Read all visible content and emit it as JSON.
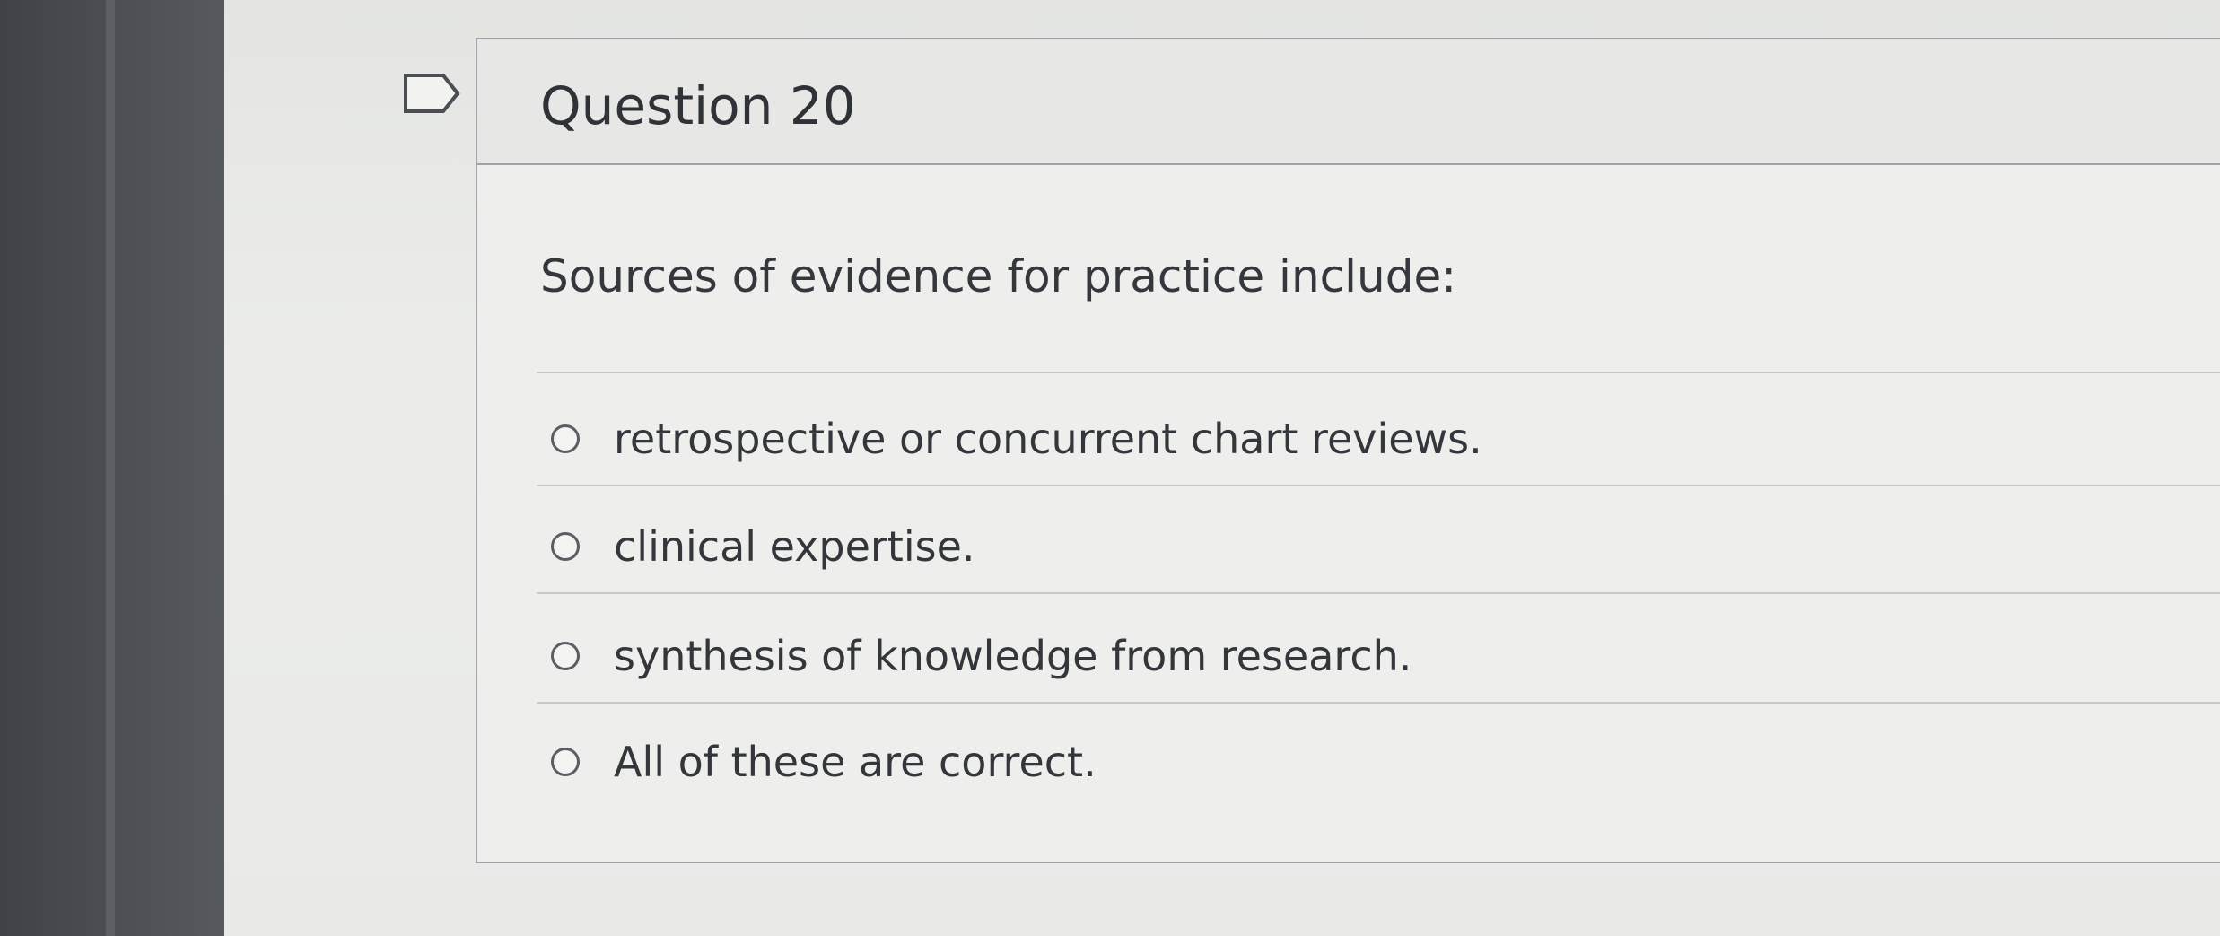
{
  "question": {
    "title": "Question 20",
    "prompt": "Sources of evidence for practice include:",
    "answers": [
      {
        "label": "retrospective or concurrent chart reviews.",
        "selected": false
      },
      {
        "label": "clinical expertise.",
        "selected": false
      },
      {
        "label": "synthesis of knowledge from research.",
        "selected": false
      },
      {
        "label": "All of these are correct.",
        "selected": false
      }
    ]
  },
  "icons": {
    "flag": "flag-icon",
    "radio": "radio-button-icon"
  },
  "colors": {
    "border": "#9fa3a6",
    "text": "#33363b",
    "card_background": "#eeefec"
  }
}
